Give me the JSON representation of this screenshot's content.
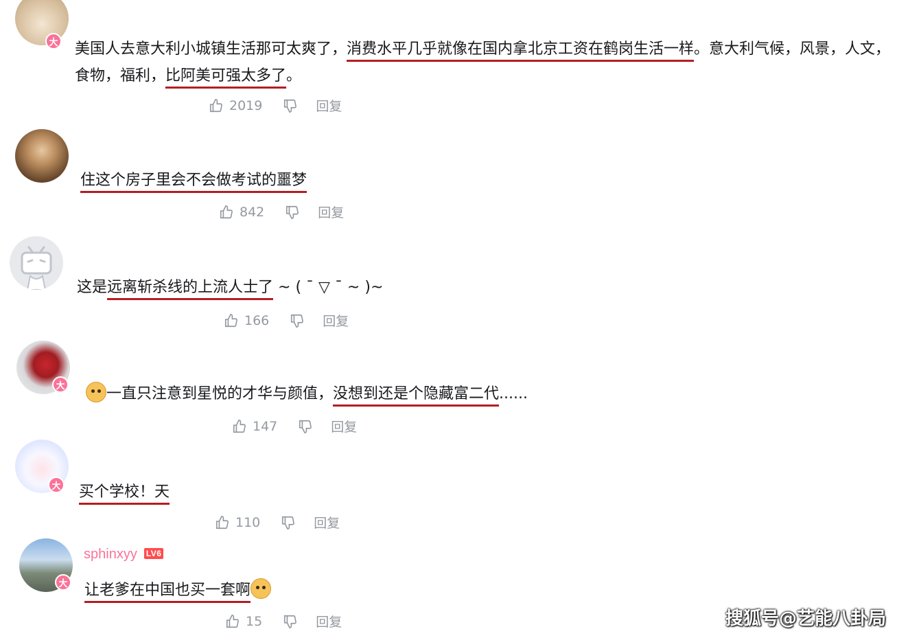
{
  "comments": [
    {
      "text_before": "美国人去意大利小城镇生活那可太爽了，",
      "text_ul1": "消费水平几乎就像在国内拿北京工资在鹤岗生活一样",
      "text_mid": "。意大利气候，风景，人文，食物，福利，",
      "text_ul2": "比阿美可强太多了",
      "text_after": "。",
      "likes": "2019",
      "reply": "回复"
    },
    {
      "text_ul": "住这个房子里会不会做考试的噩梦",
      "likes": "842",
      "reply": "回复"
    },
    {
      "text_before": "这是",
      "text_ul": "远离斩杀线的上流人士了",
      "text_after": "~ ( ˉ ▽ ˉ ~ )~",
      "likes": "166",
      "reply": "回复"
    },
    {
      "text_before": "一直只注意到星悦的才华与颜值，",
      "text_ul": "没想到还是个隐藏富二代",
      "text_after": "......",
      "likes": "147",
      "reply": "回复"
    },
    {
      "text_ul": "买个学校！天",
      "likes": "110",
      "reply": "回复"
    },
    {
      "username": "sphinxyy",
      "level": "LV6",
      "text_ul": "让老爹在中国也买一套啊",
      "likes": "15",
      "reply": "回复"
    }
  ],
  "badge_label": "大",
  "watermark": "搜狐号@艺能八卦局",
  "colors": {
    "underline": "#b51d21",
    "badge": "#fb7299",
    "action_gray": "#9499a0"
  }
}
